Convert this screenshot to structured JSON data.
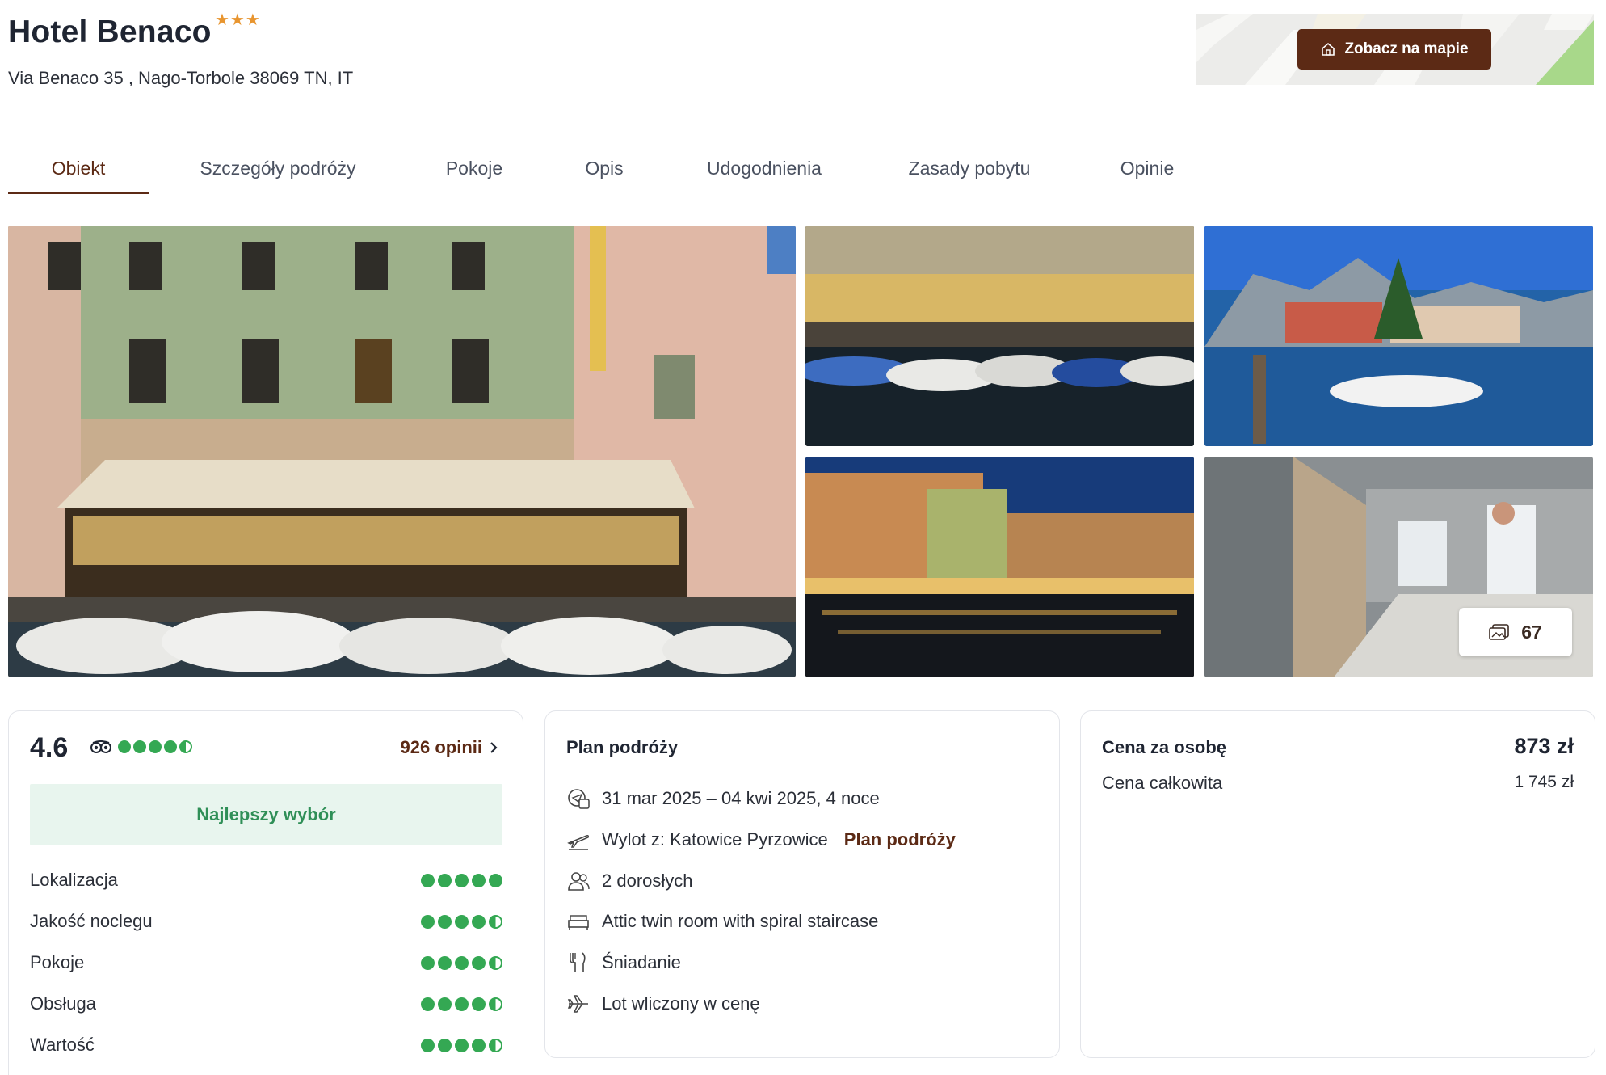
{
  "hotel": {
    "name": "Hotel Benaco",
    "stars": "★★★",
    "address": "Via Benaco 35 , Nago-Torbole 38069 TN, IT"
  },
  "map": {
    "button_label": "Zobacz na mapie",
    "icon": "home-icon"
  },
  "tabs": [
    {
      "label": "Obiekt",
      "active": true
    },
    {
      "label": "Szczegóły podróży"
    },
    {
      "label": "Pokoje"
    },
    {
      "label": "Opis"
    },
    {
      "label": "Udogodnienia"
    },
    {
      "label": "Zasady pobytu"
    },
    {
      "label": "Opinie"
    }
  ],
  "gallery": {
    "photo_count": "67",
    "icon": "photos-icon"
  },
  "rating": {
    "score": "4.6",
    "overall_dots": 4.5,
    "reviews_label": "926 opinii",
    "badge": "Najlepszy wybór",
    "subratings": [
      {
        "label": "Lokalizacja",
        "dots": 5
      },
      {
        "label": "Jakość noclegu",
        "dots": 4.5
      },
      {
        "label": "Pokoje",
        "dots": 4.5
      },
      {
        "label": "Obsługa",
        "dots": 4.5
      },
      {
        "label": "Wartość",
        "dots": 4.5
      }
    ]
  },
  "plan": {
    "title": "Plan podróży",
    "dates": "31 mar 2025 – 04 kwi 2025, 4 noce",
    "departure": "Wylot z: Katowice Pyrzowice",
    "departure_link": "Plan podróży",
    "guests": "2 dorosłych",
    "room": "Attic twin room with spiral staircase",
    "board": "Śniadanie",
    "flight": "Lot wliczony w cenę"
  },
  "price": {
    "per_person_label": "Cena za osobę",
    "per_person_value": "873 zł",
    "total_label": "Cena całkowita",
    "total_value": "1 745 zł"
  },
  "colors": {
    "brand": "#5c2a15",
    "rating_green": "#34a853",
    "badge_bg": "#e8f5ee",
    "star": "#e8952f"
  }
}
